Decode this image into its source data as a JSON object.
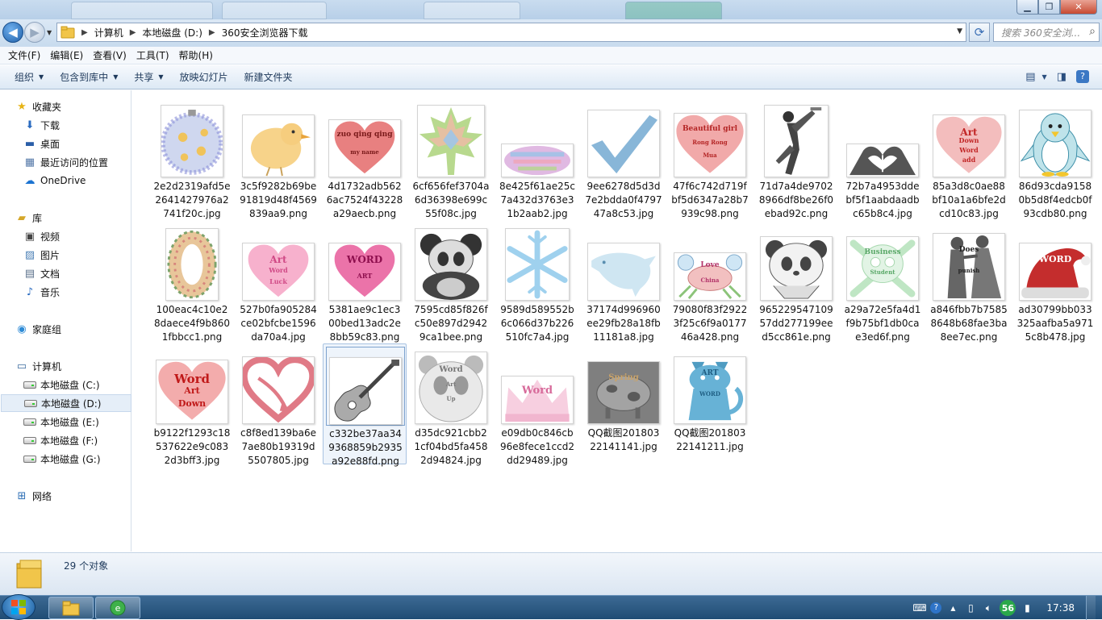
{
  "addressbar": {
    "segments": [
      "计算机",
      "本地磁盘 (D:)",
      "360安全浏览器下载"
    ]
  },
  "search": {
    "placeholder": "搜索 360安全浏..."
  },
  "menubar": [
    "文件(F)",
    "编辑(E)",
    "查看(V)",
    "工具(T)",
    "帮助(H)"
  ],
  "commandbar": [
    {
      "label": "组织",
      "dropdown": true
    },
    {
      "label": "包含到库中",
      "dropdown": true
    },
    {
      "label": "共享",
      "dropdown": true
    },
    {
      "label": "放映幻灯片",
      "dropdown": false
    },
    {
      "label": "新建文件夹",
      "dropdown": false
    }
  ],
  "navpane": {
    "favorites": {
      "label": "收藏夹",
      "items": [
        "下载",
        "桌面",
        "最近访问的位置",
        "OneDrive"
      ]
    },
    "libraries": {
      "label": "库",
      "items": [
        "视频",
        "图片",
        "文档",
        "音乐"
      ]
    },
    "homegroup": "家庭组",
    "computer": {
      "label": "计算机",
      "items": [
        "本地磁盘 (C:)",
        "本地磁盘 (D:)",
        "本地磁盘 (E:)",
        "本地磁盘 (F:)",
        "本地磁盘 (G:)"
      ],
      "selected": "本地磁盘 (D:)"
    },
    "network": "网络"
  },
  "files": [
    {
      "name": "2e2d2319afd5e2641427976a2741f20c.jpg",
      "art": "ornament"
    },
    {
      "name": "3c5f9282b69be91819d48f4569839aa9.png",
      "art": "bird"
    },
    {
      "name": "4d1732adb5626ac7524f43228a29aecb.png",
      "art": "heart-red",
      "words": [
        "zuo qing qing",
        "my name"
      ]
    },
    {
      "name": "6cf656fef3704a6d36398e699c55f08c.jpg",
      "art": "leaf"
    },
    {
      "name": "8e425f61ae25c7a432d3763e31b2aab2.jpg",
      "art": "lips"
    },
    {
      "name": "9ee6278d5d3d7e2bdda0f479747a8c53.jpg",
      "art": "check"
    },
    {
      "name": "47f6c742d719fbf5d6347a28b7939c98.png",
      "art": "heart-words",
      "words": [
        "Beautiful girl",
        "Rong Rong",
        "Mua"
      ]
    },
    {
      "name": "71d7a4de97028966df8be26f0ebad92c.png",
      "art": "dunk"
    },
    {
      "name": "72b7a4953ddebf5f1aabdaadbc65b8c4.jpg",
      "art": "hands"
    },
    {
      "name": "85a3d8c0ae88bf10a1a6bfe2dcd10c83.jpg",
      "art": "heart-down",
      "words": [
        "Art",
        "Down",
        "Word",
        "add"
      ]
    },
    {
      "name": "86d93cda91580b5d8f4edcb0f93cdb80.png",
      "art": "penguin"
    },
    {
      "name": "100eac4c10e28daece4f9b8601fbbcc1.png",
      "art": "zero"
    },
    {
      "name": "527b0fa905284ce02bfcbe1596da70a4.jpg",
      "art": "heart-word-pink",
      "words": [
        "Art",
        "Word",
        "Luck"
      ]
    },
    {
      "name": "5381ae9c1ec300bed13adc2e8bb59c83.png",
      "art": "heart-magenta",
      "words": [
        "WORD",
        "ART"
      ]
    },
    {
      "name": "7595cd85f826fc50e897d29429ca1bee.png",
      "art": "panda-dark"
    },
    {
      "name": "9589d589552b6c066d37b226510fc7a4.jpg",
      "art": "snowflake"
    },
    {
      "name": "37174d996960ee29fb28a18fb11181a8.jpg",
      "art": "dolphin"
    },
    {
      "name": "79080f83f29223f25c6f9a017746a428.png",
      "art": "crab",
      "words": [
        "Love",
        "China"
      ]
    },
    {
      "name": "96522954710957dd277199eed5cc861e.png",
      "art": "panda-outline"
    },
    {
      "name": "a29a72e5fa4d1f9b75bf1db0cae3ed6f.png",
      "art": "skull",
      "words": [
        "Business",
        "Student"
      ]
    },
    {
      "name": "a846fbb7b75858648b68fae3ba8ee7ec.png",
      "art": "couple",
      "words": [
        "Does",
        "punish"
      ]
    },
    {
      "name": "ad30799bb033325aafba5a9715c8b478.jpg",
      "art": "hat",
      "words": [
        "WORD"
      ]
    },
    {
      "name": "b9122f1293c18537622e9c0832d3bff3.jpg",
      "art": "heart-word-red",
      "words": [
        "Word",
        "Art",
        "Down"
      ]
    },
    {
      "name": "c8f8ed139ba6e7ae80b19319d5507805.jpg",
      "art": "heart-arrow"
    },
    {
      "name": "c332be37aa349368859b2935a92e88fd.png",
      "art": "guitar",
      "selected": true
    },
    {
      "name": "d35dc921cbb21cf04bd5fa4582d94824.jpg",
      "art": "panda-gray",
      "words": [
        "Word",
        "Art",
        "Up"
      ]
    },
    {
      "name": "e09db0c846cb96e8fece1ccd2dd29489.jpg",
      "art": "crown",
      "words": [
        "Word"
      ]
    },
    {
      "name": "QQ截图20180322141141.jpg",
      "art": "cow",
      "words": [
        "Spring"
      ]
    },
    {
      "name": "QQ截图20180322141211.jpg",
      "art": "cat",
      "words": [
        "ART",
        "WORD"
      ]
    }
  ],
  "status": {
    "count": "29 个对象"
  },
  "taskbar": {
    "clock": "17:38",
    "tray_badge": "56"
  },
  "colors": {
    "accent": "#1e395b",
    "selection": "#e5eef8",
    "taskbar": "#2b5a85"
  }
}
